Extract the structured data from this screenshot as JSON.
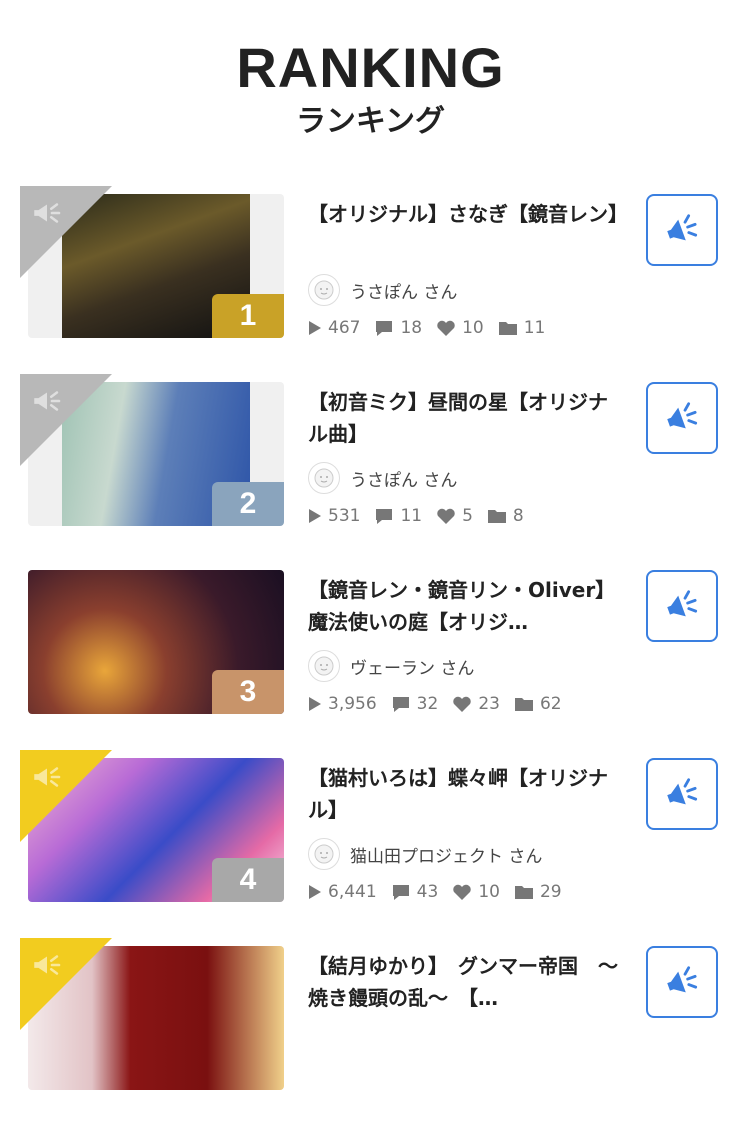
{
  "header": {
    "title": "RANKING",
    "subtitle": "ランキング"
  },
  "items": [
    {
      "rank": "1",
      "title": "【オリジナル】さなぎ【鏡音レン】",
      "user": "うさぽん さん",
      "plays": "467",
      "comments": "18",
      "likes": "10",
      "lists": "11",
      "rank_color": "#c9a227",
      "corner_color": "#b8b8b8",
      "thumb": "narrow"
    },
    {
      "rank": "2",
      "title": "【初音ミク】昼間の星【オリジナル曲】",
      "user": "うさぽん さん",
      "plays": "531",
      "comments": "11",
      "likes": "5",
      "lists": "8",
      "rank_color": "#8aa4bd",
      "corner_color": "#b8b8b8",
      "thumb": "narrow"
    },
    {
      "rank": "3",
      "title": "【鏡音レン・鏡音リン・Oliver】魔法使いの庭【オリジ…",
      "user": "ヴェーラン さん",
      "plays": "3,956",
      "comments": "32",
      "likes": "23",
      "lists": "62",
      "rank_color": "#c8946a",
      "corner_color": "",
      "thumb": "full"
    },
    {
      "rank": "4",
      "title": "【猫村いろは】蝶々岬【オリジナル】",
      "user": "猫山田プロジェクト さん",
      "plays": "6,441",
      "comments": "43",
      "likes": "10",
      "lists": "29",
      "rank_color": "#a8a8a8",
      "corner_color": "#f2cc1f",
      "thumb": "full"
    },
    {
      "rank": "",
      "title": "【結月ゆかり】　グンマー帝国　～焼き饅頭の乱～　【…",
      "user": "",
      "plays": "",
      "comments": "",
      "likes": "",
      "lists": "",
      "rank_color": "",
      "corner_color": "#f2cc1f",
      "thumb": "full"
    }
  ],
  "icons": {
    "promote": "megaphone-icon",
    "play": "play-icon",
    "comment": "comment-icon",
    "like": "heart-icon",
    "mylist": "folder-icon"
  },
  "colors": {
    "accent": "#3a7fe0",
    "text": "#222222",
    "muted": "#777777"
  }
}
